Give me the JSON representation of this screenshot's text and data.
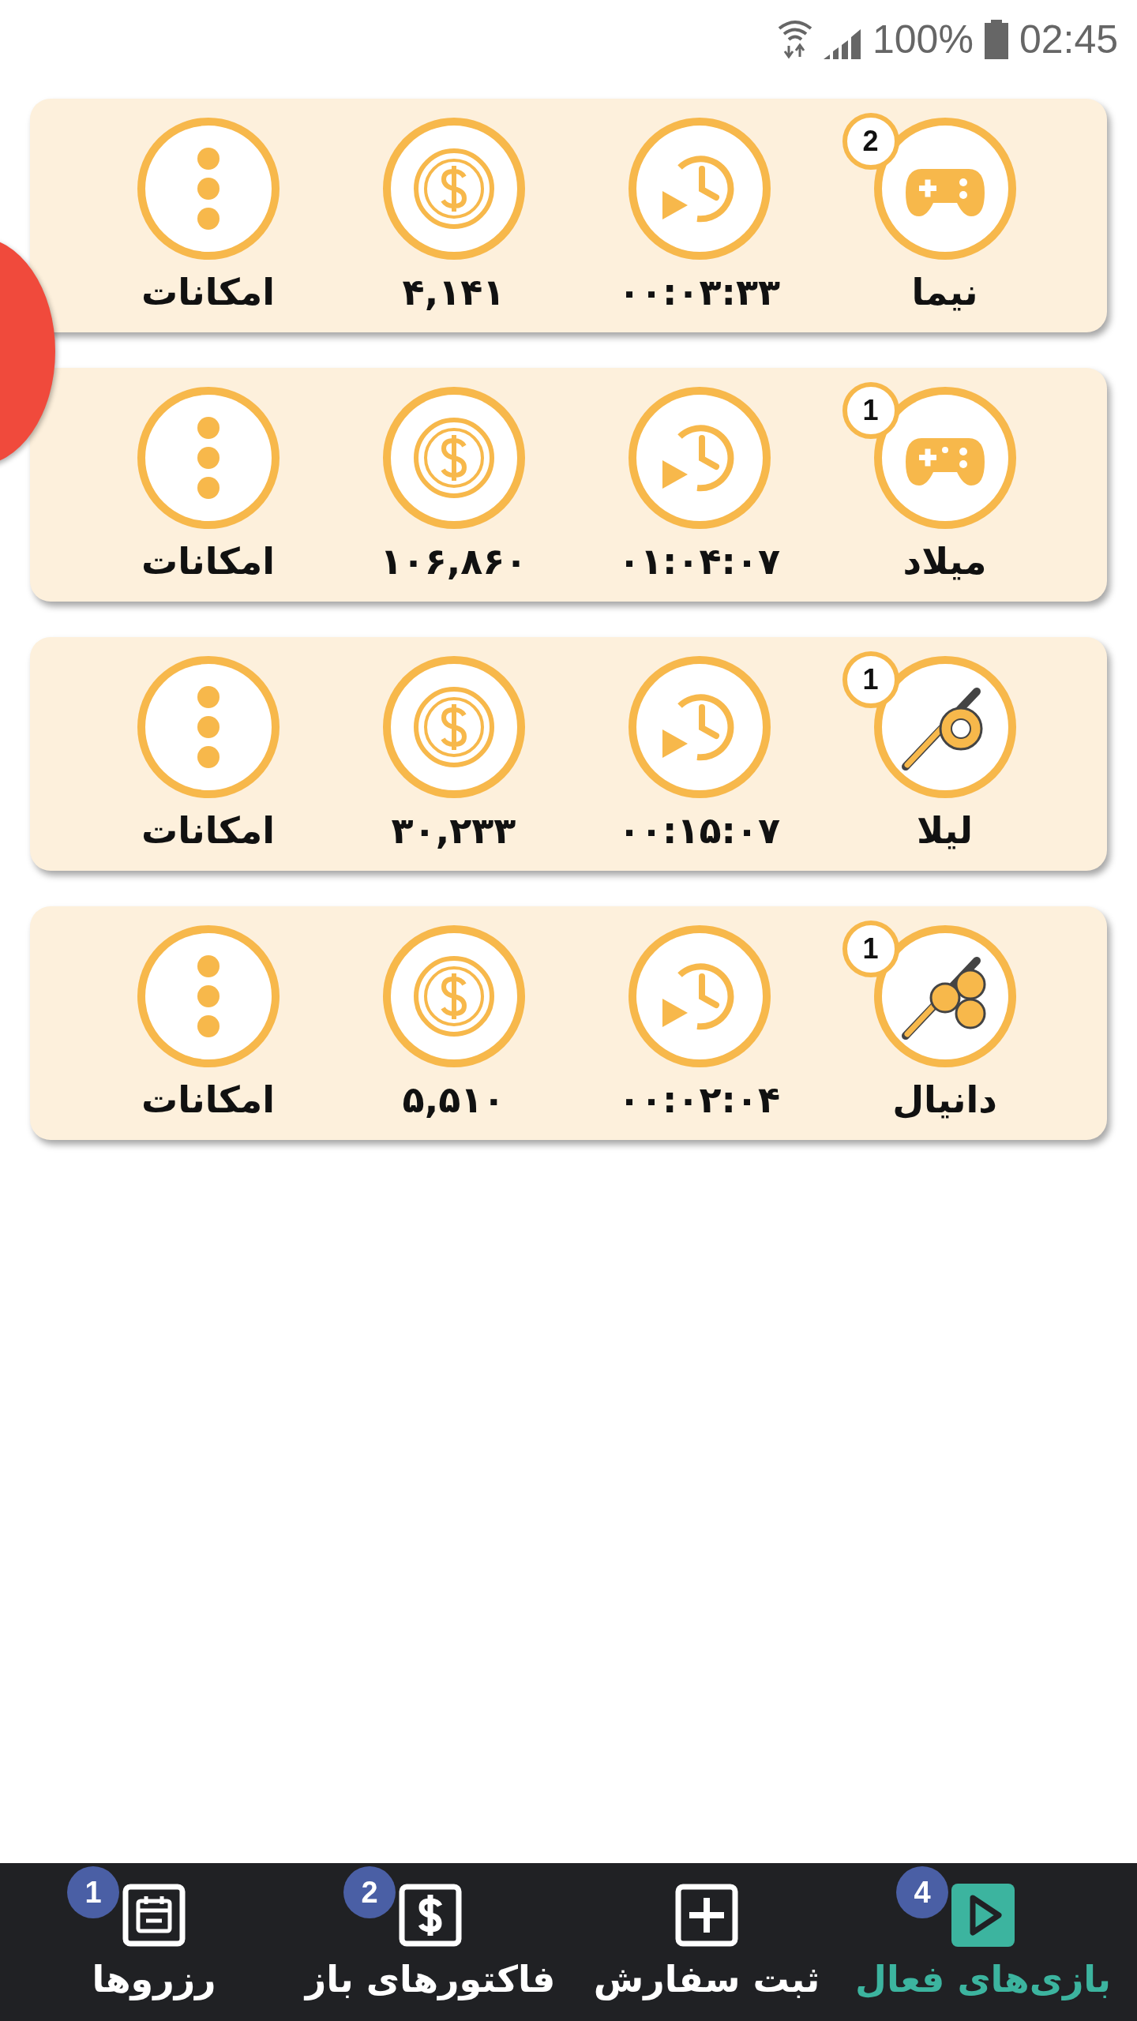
{
  "status_bar": {
    "battery": "100%",
    "time": "02:45"
  },
  "sessions": [
    {
      "kind": "ps4",
      "count": "2",
      "name": "نیما",
      "time": "۰۰:۰۳:۳۳",
      "amount": "۴,۱۴۱",
      "options": "امکانات"
    },
    {
      "kind": "ps5",
      "count": "1",
      "name": "میلاد",
      "time": "۰۱:۰۴:۰۷",
      "amount": "۱۰۶,۸۶۰",
      "options": "امکانات"
    },
    {
      "kind": "billiard",
      "count": "1",
      "name": "لیلا",
      "time": "۰۰:۱۵:۰۷",
      "amount": "۳۰,۲۳۳",
      "options": "امکانات"
    },
    {
      "kind": "snooker",
      "count": "1",
      "name": "دانیال",
      "time": "۰۰:۰۲:۰۴",
      "amount": "۵,۵۱۰",
      "options": "امکانات"
    }
  ],
  "bottom_nav": [
    {
      "kind": "play",
      "label": "بازی‌های فعال",
      "badge": "4",
      "selected": true
    },
    {
      "kind": "add",
      "label": "ثبت سفارش",
      "selected": false
    },
    {
      "kind": "invoice",
      "label": "فاکتورهای باز",
      "badge": "2",
      "selected": false
    },
    {
      "kind": "calendar",
      "label": "رزروها",
      "badge": "1",
      "selected": false
    }
  ]
}
